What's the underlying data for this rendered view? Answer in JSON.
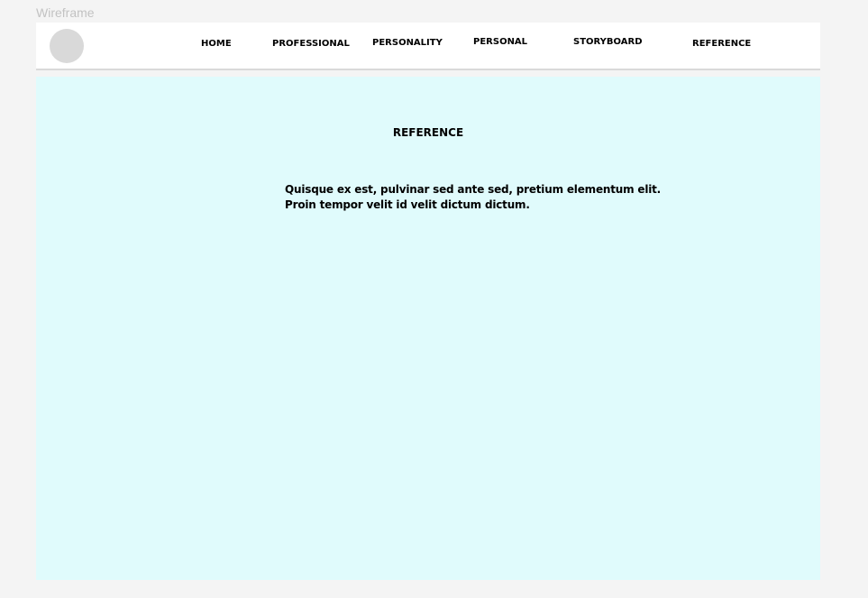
{
  "frame": {
    "label": "Wireframe"
  },
  "header": {
    "nav": [
      {
        "label": "HOME"
      },
      {
        "label": "PROFESSIONAL"
      },
      {
        "label": "PERSONALITY"
      },
      {
        "label": "PERSONAL"
      },
      {
        "label": "STORYBOARD"
      },
      {
        "label": "REFERENCE"
      }
    ]
  },
  "main": {
    "title": "REFERENCE",
    "body_lines": [
      "Quisque ex est, pulvinar sed ante sed, pretium elementum elit.",
      "Proin tempor velit id velit dictum dictum."
    ]
  },
  "colors": {
    "page_background": "#f4f4f4",
    "header_background": "#ffffff",
    "content_background": "#e0fbfc",
    "logo_placeholder": "#d9d9d9"
  }
}
